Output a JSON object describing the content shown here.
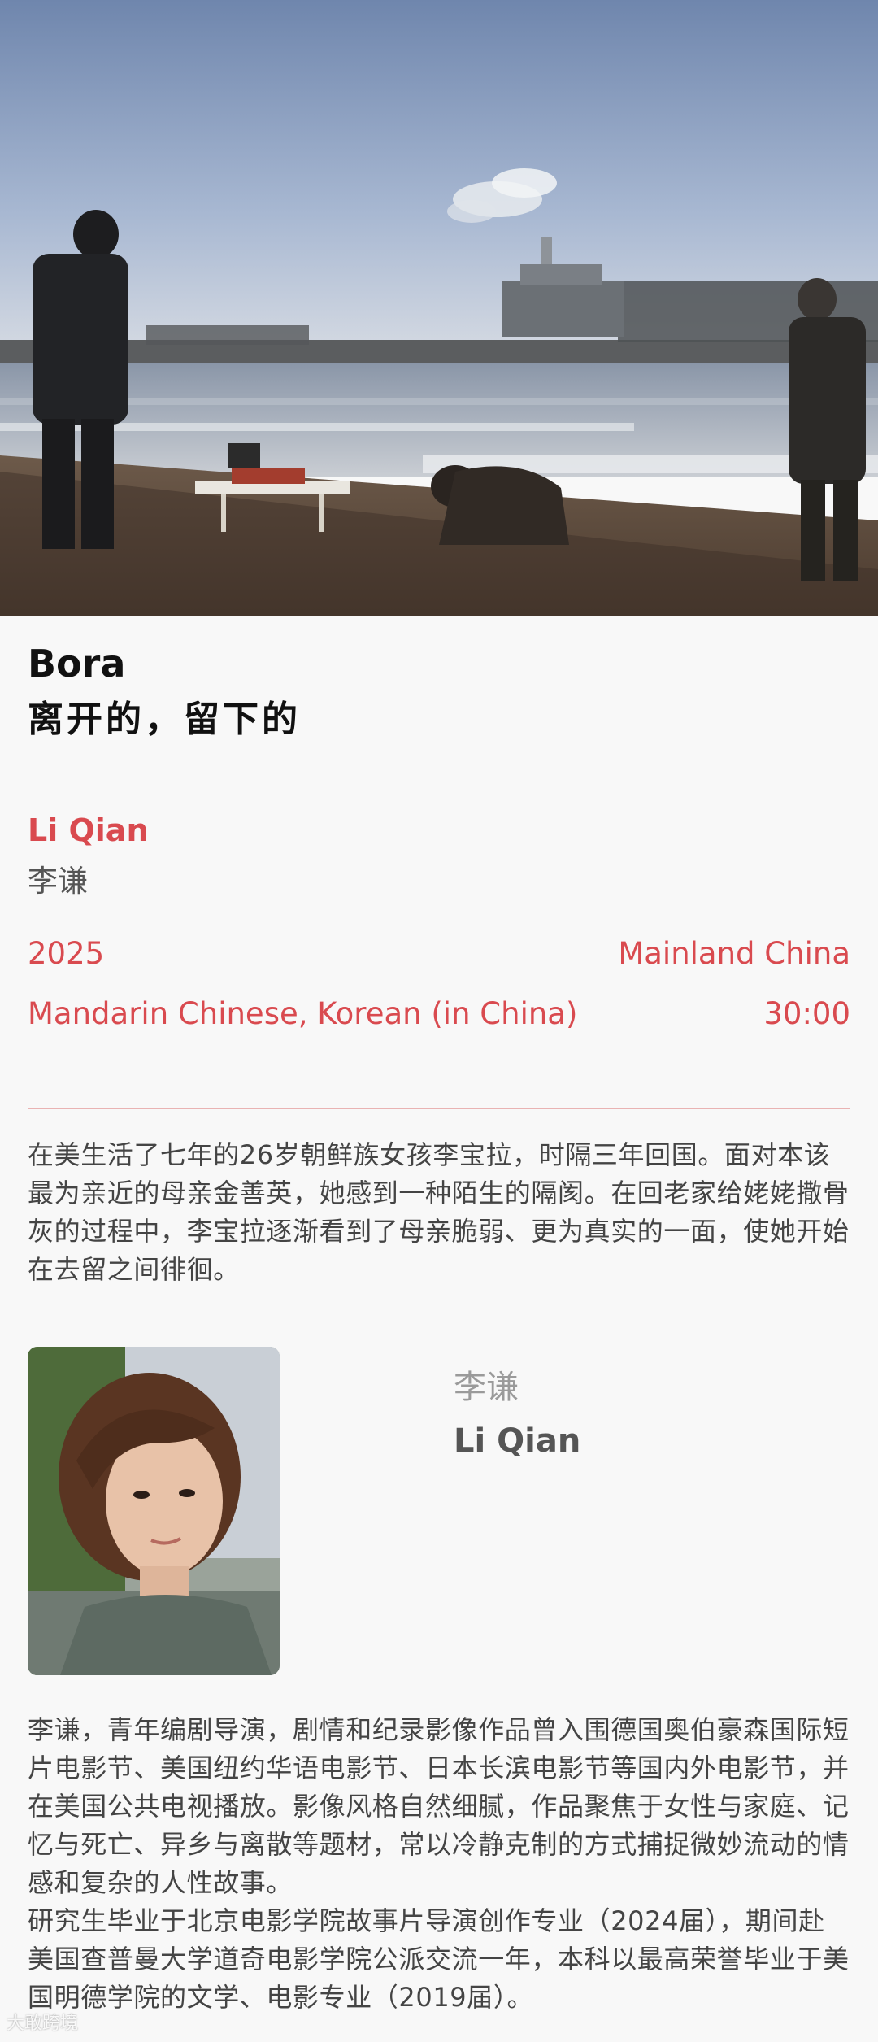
{
  "film": {
    "title_en": "Bora",
    "title_zh": "离开的，留下的"
  },
  "director": {
    "name_en": "Li Qian",
    "name_zh": "李谦"
  },
  "meta": {
    "year": "2025",
    "region": "Mainland China",
    "language": "Mandarin Chinese, Korean (in China)",
    "duration": "30:00"
  },
  "synopsis": "在美生活了七年的26岁朝鲜族女孩李宝拉，时隔三年回国。面对本该最为亲近的母亲金善英，她感到一种陌生的隔阂。在回老家给姥姥撒骨灰的过程中，李宝拉逐渐看到了母亲脆弱、更为真实的一面，使她开始在去留之间徘徊。",
  "director_card": {
    "name_zh": "李谦",
    "name_en": "Li Qian"
  },
  "bio": {
    "paragraph_1": "李谦，青年编剧导演，剧情和纪录影像作品曾入围德国奥伯豪森国际短片电影节、美国纽约华语电影节、日本长滨电影节等国内外电影节，并在美国公共电视播放。影像风格自然细腻，作品聚焦于女性与家庭、记忆与死亡、异乡与离散等题材，常以冷静克制的方式捕捉微妙流动的情感和复杂的人性故事。",
    "paragraph_2": "研究生毕业于北京电影学院故事片导演创作专业（2024届），期间赴美国查普曼大学道奇电影学院公派交流一年，本科以最高荣誉毕业于美国明德学院的文学、电影专业（2019届）。"
  },
  "watermark": "大敢跨境",
  "colors": {
    "accent": "#d94a4f",
    "divider": "#e9b3b3",
    "body_text": "#444444",
    "background": "#f8f8f8"
  }
}
